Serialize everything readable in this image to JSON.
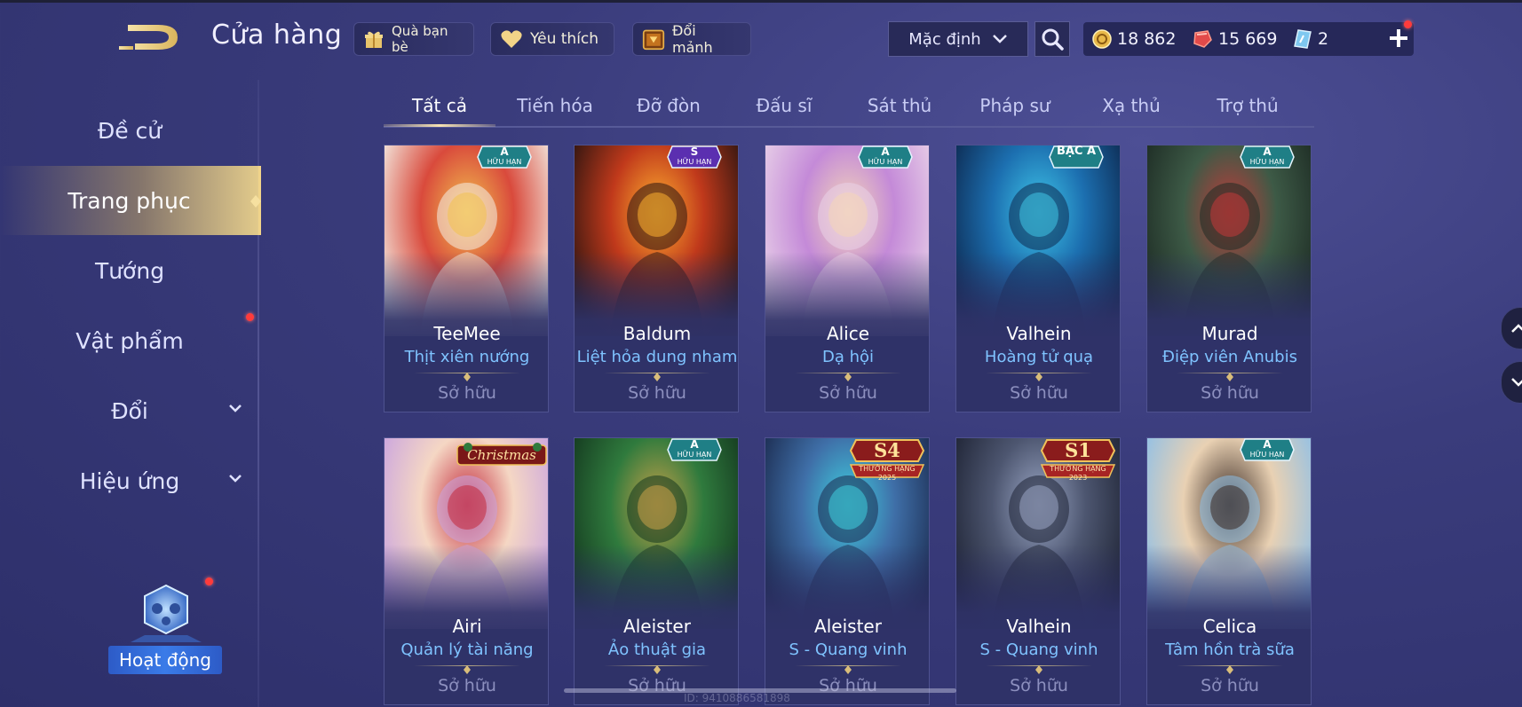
{
  "header": {
    "title": "Cửa hàng",
    "chips": [
      {
        "label": "Quà bạn bè",
        "icon": "gift-icon"
      },
      {
        "label": "Yêu thích",
        "icon": "heart-icon"
      },
      {
        "label": "Đổi mảnh",
        "icon": "fragment-chest-icon"
      }
    ],
    "sort": {
      "selected": "Mặc định"
    },
    "currencies": {
      "gold": "18 862",
      "ruby": "15 669",
      "voucher": "2"
    }
  },
  "sidebar": {
    "items": [
      {
        "label": "Đề cử",
        "active": false
      },
      {
        "label": "Trang phục",
        "active": true
      },
      {
        "label": "Tướng",
        "active": false
      },
      {
        "label": "Vật phẩm",
        "active": false,
        "notification": true
      },
      {
        "label": "Đổi",
        "active": false,
        "expandable": true
      },
      {
        "label": "Hiệu ứng",
        "active": false,
        "expandable": true
      }
    ],
    "activity_label": "Hoạt động"
  },
  "tabs": [
    {
      "label": "Tất cả",
      "active": true
    },
    {
      "label": "Tiến hóa",
      "active": false
    },
    {
      "label": "Đỡ đòn",
      "active": false
    },
    {
      "label": "Đấu sĩ",
      "active": false
    },
    {
      "label": "Sát thủ",
      "active": false
    },
    {
      "label": "Pháp sư",
      "active": false
    },
    {
      "label": "Xạ thủ",
      "active": false
    },
    {
      "label": "Trợ thủ",
      "active": false
    }
  ],
  "cards": [
    {
      "hero": "TeeMee",
      "skin": "Thịt xiên nướng",
      "status": "Sở hữu",
      "badge_top": "A",
      "badge_bottom": "HỮU HẠN",
      "colors": [
        "#f4efe6",
        "#d94a3c",
        "#f2c14e"
      ]
    },
    {
      "hero": "Baldum",
      "skin": "Liệt hỏa dung nham",
      "status": "Sở hữu",
      "badge_top": "S",
      "badge_bottom": "HỮU HẠN",
      "colors": [
        "#2a1410",
        "#c0391b",
        "#ffb030"
      ]
    },
    {
      "hero": "Alice",
      "skin": "Dạ hội",
      "status": "Sở hữu",
      "badge_top": "A",
      "badge_bottom": "HỮU HẠN",
      "colors": [
        "#e9d2e8",
        "#c48ad8",
        "#f4d6b8"
      ]
    },
    {
      "hero": "Valhein",
      "skin": "Hoàng tử quạ",
      "status": "Sở hữu",
      "badge_top": "BẬC A",
      "badge_bottom": "",
      "colors": [
        "#0d2950",
        "#1c6fb0",
        "#3fc6e8"
      ]
    },
    {
      "hero": "Murad",
      "skin": "Điệp viên Anubis",
      "status": "Sở hữu",
      "badge_top": "A",
      "badge_bottom": "HỮU HẠN",
      "colors": [
        "#1d2b24",
        "#3d5a46",
        "#c23a3a"
      ]
    },
    {
      "hero": "Airi",
      "skin": "Quản lý tài năng",
      "status": "Sở hữu",
      "badge_top": "Christmas",
      "badge_bottom": "",
      "colors": [
        "#c9a3e0",
        "#f5d7c4",
        "#c2283a"
      ]
    },
    {
      "hero": "Aleister",
      "skin": "Ảo thuật gia",
      "status": "Sở hữu",
      "badge_top": "A",
      "badge_bottom": "HỮU HẠN",
      "colors": [
        "#14381f",
        "#2f7a3d",
        "#c9a24a"
      ]
    },
    {
      "hero": "Aleister",
      "skin": "S - Quang vinh",
      "status": "Sở hữu",
      "badge_top": "S4",
      "badge_bottom": "THƯỞNG HẠNG 2025",
      "colors": [
        "#1b2a4e",
        "#3f6fa8",
        "#3fd0e0"
      ]
    },
    {
      "hero": "Valhein",
      "skin": "S - Quang vinh",
      "status": "Sở hữu",
      "badge_top": "S1",
      "badge_bottom": "THƯỞNG HẠNG 2023",
      "colors": [
        "#1e2334",
        "#4d5670",
        "#9aa6c4"
      ]
    },
    {
      "hero": "Celica",
      "skin": "Tâm hồn trà sữa",
      "status": "Sở hữu",
      "badge_top": "A",
      "badge_bottom": "HỮU HẠN",
      "colors": [
        "#8dbfe8",
        "#e9d1b3",
        "#3a2a24"
      ]
    }
  ],
  "footer": {
    "player_id": "ID: 9410886581898"
  },
  "theme": {
    "accent_gold": "#f0d48a",
    "skin_name_blue": "#7fc3ff",
    "notify_red": "#ff3b3b"
  }
}
